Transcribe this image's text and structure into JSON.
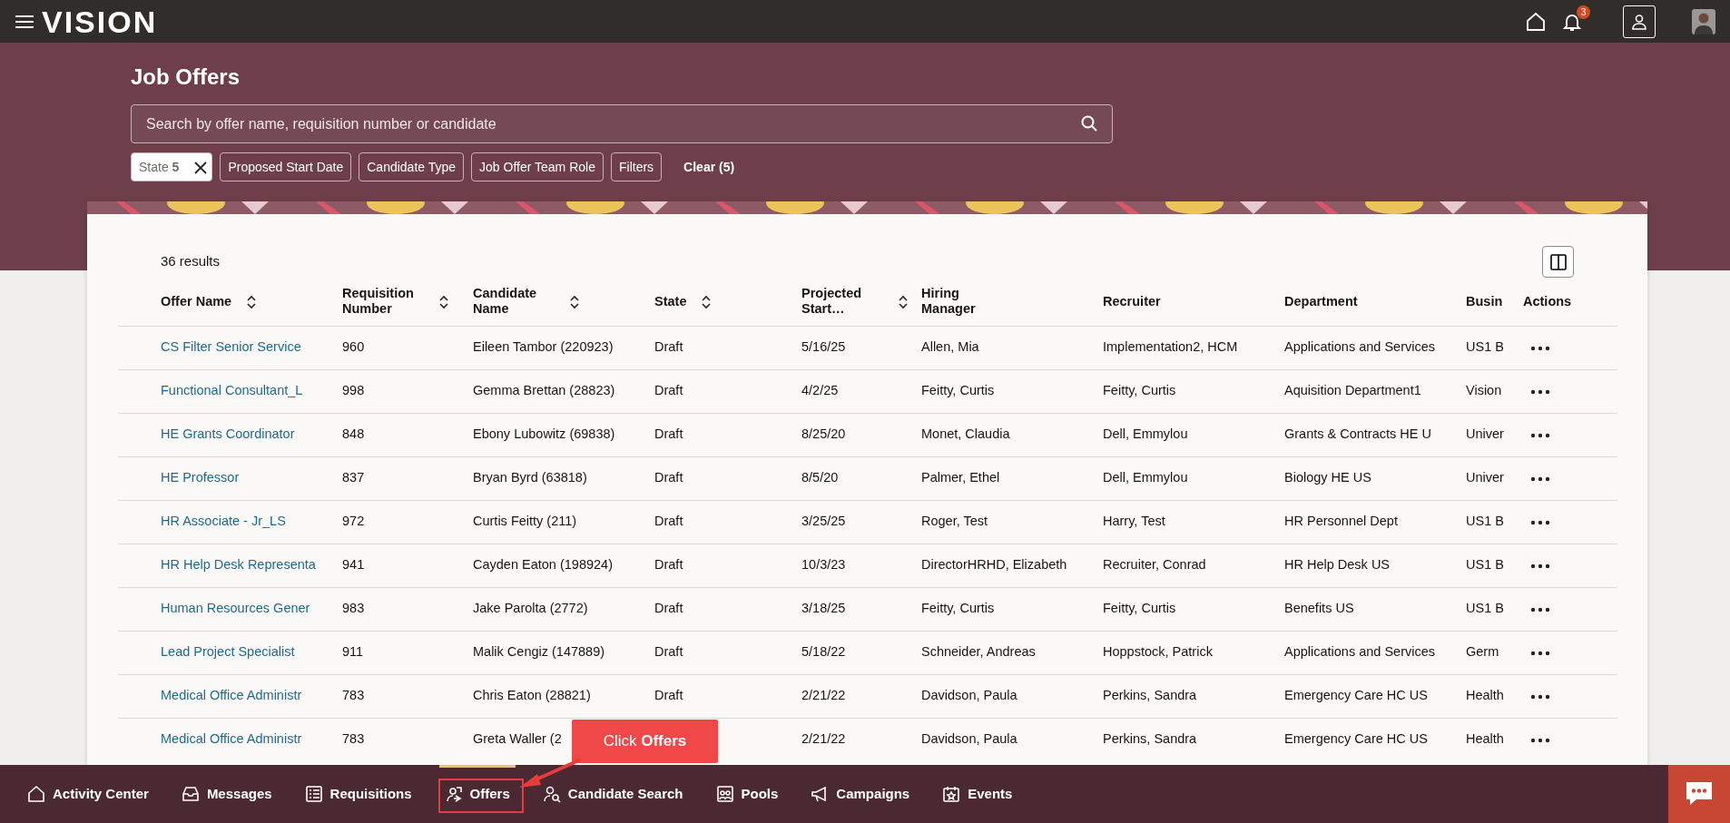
{
  "topbar": {
    "logo": "VISION",
    "notification_count": "3"
  },
  "header": {
    "title": "Job Offers",
    "search": {
      "placeholder": "Search by offer name, requisition number or candidate"
    },
    "filters": [
      {
        "kind": "applied",
        "label": "State",
        "value": "5"
      },
      {
        "kind": "chip",
        "label": "Proposed Start Date"
      },
      {
        "kind": "chip",
        "label": "Candidate Type"
      },
      {
        "kind": "chip",
        "label": "Job Offer Team Role"
      },
      {
        "kind": "chip",
        "label": "Filters"
      }
    ],
    "clear": "Clear (5)"
  },
  "results": {
    "count": "36 results",
    "columns": [
      {
        "label": "Offer Name",
        "sortable": true
      },
      {
        "label": "Requisition Number",
        "sortable": true
      },
      {
        "label": "Candidate Name",
        "sortable": true
      },
      {
        "label": "State",
        "sortable": true
      },
      {
        "label": "Projected Start…",
        "sortable": true
      },
      {
        "label": "Hiring Manager",
        "sortable": false
      },
      {
        "label": "Recruiter",
        "sortable": false
      },
      {
        "label": "Department",
        "sortable": false
      },
      {
        "label": "Busin",
        "sortable": false
      },
      {
        "label": "Actions",
        "sortable": false
      }
    ],
    "rows": [
      [
        "CS Filter Senior Service",
        "960",
        "Eileen Tambor (220923)",
        "Draft",
        "5/16/25",
        "Allen, Mia",
        "Implementation2, HCM",
        "Applications and Services",
        "US1 B"
      ],
      [
        "Functional Consultant_L",
        "998",
        "Gemma Brettan (28823)",
        "Draft",
        "4/2/25",
        "Feitty, Curtis",
        "Feitty, Curtis",
        "Aquisition Department1",
        "Vision"
      ],
      [
        "HE Grants Coordinator",
        "848",
        "Ebony Lubowitz (69838)",
        "Draft",
        "8/25/20",
        "Monet, Claudia",
        "Dell, Emmylou",
        "Grants & Contracts HE U",
        "Univer"
      ],
      [
        "HE Professor",
        "837",
        "Bryan Byrd (63818)",
        "Draft",
        "8/5/20",
        "Palmer, Ethel",
        "Dell, Emmylou",
        "Biology HE US",
        "Univer"
      ],
      [
        "HR Associate - Jr_LS",
        "972",
        "Curtis Feitty (211)",
        "Draft",
        "3/25/25",
        "Roger, Test",
        "Harry, Test",
        "HR Personnel Dept",
        "US1 B"
      ],
      [
        "HR Help Desk Representa",
        "941",
        "Cayden Eaton (198924)",
        "Draft",
        "10/3/23",
        "DirectorHRHD, Elizabeth",
        "Recruiter, Conrad",
        "HR Help Desk US",
        "US1 B"
      ],
      [
        "Human Resources Gener",
        "983",
        "Jake Parolta (2772)",
        "Draft",
        "3/18/25",
        "Feitty, Curtis",
        "Feitty, Curtis",
        "Benefits US",
        "US1 B"
      ],
      [
        "Lead Project Specialist",
        "911",
        "Malik Cengiz (147889)",
        "Draft",
        "5/18/22",
        "Schneider, Andreas",
        "Hoppstock, Patrick",
        "Applications and Services",
        "Germ"
      ],
      [
        "Medical Office Administr",
        "783",
        "Chris Eaton (28821)",
        "Draft",
        "2/21/22",
        "Davidson, Paula",
        "Perkins, Sandra",
        "Emergency Care HC US",
        "Health"
      ],
      [
        "Medical Office Administr",
        "783",
        "Greta Waller (2",
        null,
        "2/21/22",
        "Davidson, Paula",
        "Perkins, Sandra",
        "Emergency Care HC US",
        "Health"
      ]
    ]
  },
  "bottom_nav": [
    {
      "label": "Activity Center",
      "selected": false
    },
    {
      "label": "Messages",
      "selected": false
    },
    {
      "label": "Requisitions",
      "selected": false
    },
    {
      "label": "Offers",
      "selected": true
    },
    {
      "label": "Candidate Search",
      "selected": false
    },
    {
      "label": "Pools",
      "selected": false
    },
    {
      "label": "Campaigns",
      "selected": false
    },
    {
      "label": "Events",
      "selected": false
    }
  ],
  "callout": {
    "text": "Click **Offers**"
  }
}
